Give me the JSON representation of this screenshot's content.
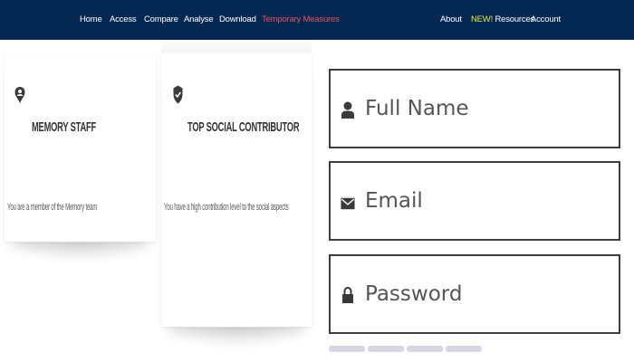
{
  "nav": {
    "left_items": [
      "Home",
      "Access",
      "Compare",
      "Analyse",
      "Download",
      "Temporary Measures"
    ],
    "new_badge": "NEW!",
    "right_items": [
      "About",
      "Resources",
      "Account"
    ]
  },
  "cards": [
    {
      "icon": "person-badge-icon",
      "title": "MEMORY STAFF",
      "text": "You are a member of the Memory team"
    },
    {
      "icon": "shield-check-icon",
      "title": "TOP SOCIAL CONTRIBUTOR",
      "text": "You have a high contribution level to the social aspects"
    }
  ],
  "form": {
    "full_name": {
      "placeholder": "Full Name",
      "icon": "user-icon"
    },
    "email": {
      "placeholder": "Email",
      "icon": "envelope-icon"
    },
    "password": {
      "placeholder": "Password",
      "icon": "lock-icon"
    },
    "strength_segments": 4
  },
  "colors": {
    "nav_bg": "#052852",
    "accent_red": "#e8525b",
    "new_yellow": "#e4e63a",
    "border": "#3d3d3d"
  }
}
